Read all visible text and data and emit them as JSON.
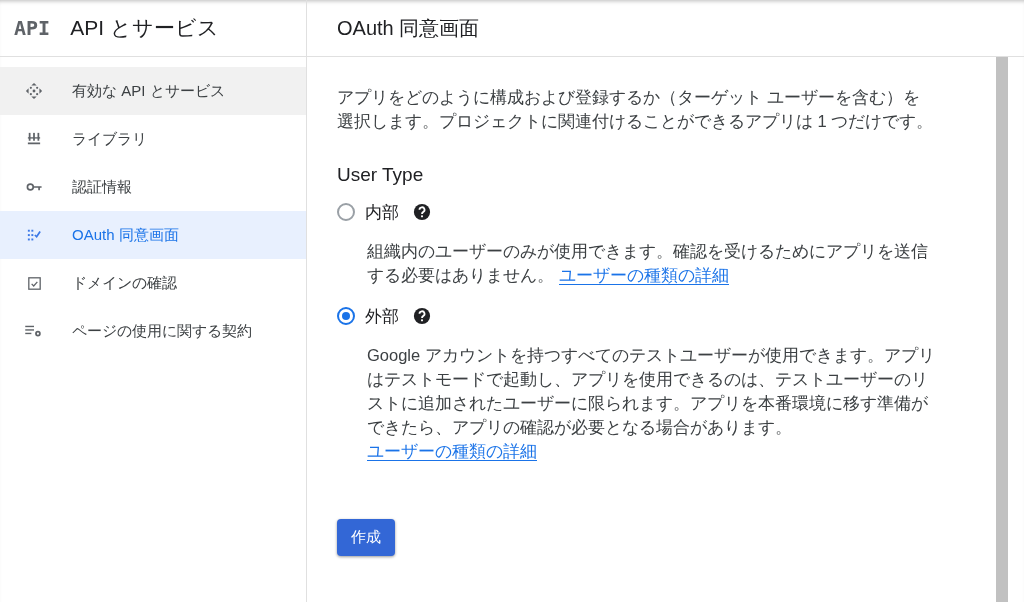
{
  "sidebar": {
    "logo": "API",
    "title": "API とサービス",
    "items": [
      {
        "label": "有効な API とサービス",
        "selected": false,
        "highlighted": true
      },
      {
        "label": "ライブラリ",
        "selected": false,
        "highlighted": false
      },
      {
        "label": "認証情報",
        "selected": false,
        "highlighted": false
      },
      {
        "label": "OAuth 同意画面",
        "selected": true,
        "highlighted": false
      },
      {
        "label": "ドメインの確認",
        "selected": false,
        "highlighted": false
      },
      {
        "label": "ページの使用に関する契約",
        "selected": false,
        "highlighted": false
      }
    ]
  },
  "page": {
    "title": "OAuth 同意画面",
    "intro": "アプリをどのように構成および登録するか（ターゲット ユーザーを含む）を選択します。プロジェクトに関連付けることができるアプリは 1 つだけです。",
    "section_title": "User Type",
    "options": [
      {
        "label": "内部",
        "selected": false,
        "description": "組織内のユーザーのみが使用できます。確認を受けるためにアプリを送信する必要はありません。",
        "link": "ユーザーの種類の詳細"
      },
      {
        "label": "外部",
        "selected": true,
        "description": "Google アカウントを持つすべてのテストユーザーが使用できます。アプリはテストモードで起動し、アプリを使用できるのは、テストユーザーのリストに追加されたユーザーに限られます。アプリを本番環境に移す準備ができたら、アプリの確認が必要となる場合があります。",
        "link": "ユーザーの種類の詳細"
      }
    ],
    "button": "作成"
  }
}
